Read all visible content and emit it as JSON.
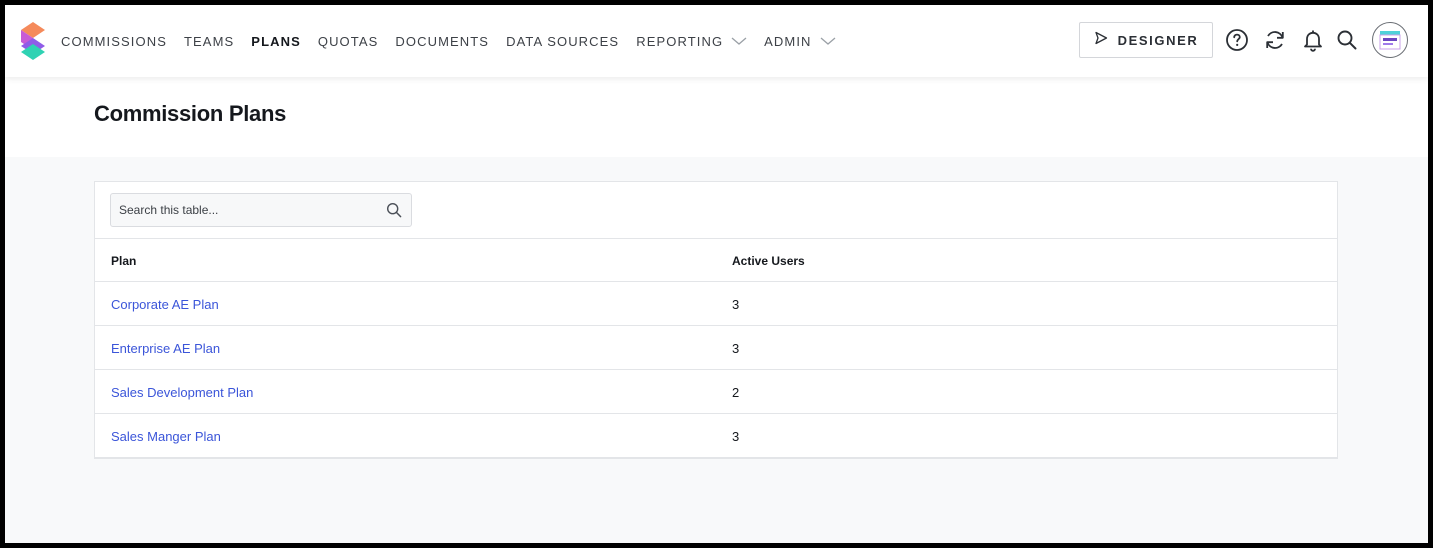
{
  "nav": {
    "items": [
      {
        "label": "COMMISSIONS",
        "active": false,
        "dropdown": false
      },
      {
        "label": "TEAMS",
        "active": false,
        "dropdown": false
      },
      {
        "label": "PLANS",
        "active": true,
        "dropdown": false
      },
      {
        "label": "QUOTAS",
        "active": false,
        "dropdown": false
      },
      {
        "label": "DOCUMENTS",
        "active": false,
        "dropdown": false
      },
      {
        "label": "DATA SOURCES",
        "active": false,
        "dropdown": false
      },
      {
        "label": "REPORTING",
        "active": false,
        "dropdown": true
      },
      {
        "label": "ADMIN",
        "active": false,
        "dropdown": true
      }
    ],
    "designer_label": "DESIGNER",
    "icons": [
      "help-icon",
      "refresh-icon",
      "bell-icon",
      "search-icon"
    ]
  },
  "page": {
    "title": "Commission Plans"
  },
  "table": {
    "search_placeholder": "Search this table...",
    "columns": [
      "Plan",
      "Active Users"
    ],
    "rows": [
      {
        "plan": "Corporate AE Plan",
        "active_users": "3"
      },
      {
        "plan": "Enterprise AE Plan",
        "active_users": "3"
      },
      {
        "plan": "Sales Development Plan",
        "active_users": "2"
      },
      {
        "plan": "Sales Manger Plan",
        "active_users": "3"
      }
    ]
  },
  "colors": {
    "link": "#3b55d9",
    "text": "#15181d",
    "background": "#f8f9fa"
  }
}
